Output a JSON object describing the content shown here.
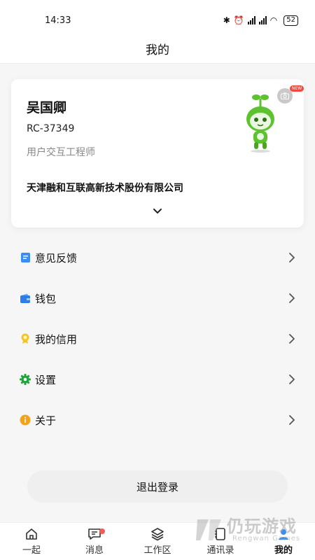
{
  "status_bar": {
    "time": "14:33",
    "battery": "52"
  },
  "header": {
    "title": "我的"
  },
  "profile": {
    "name": "吴国卿",
    "id": "RC-37349",
    "role": "用户交互工程师",
    "company": "天津融和互联高新技术股份有限公司",
    "badge": "NEW"
  },
  "menu": {
    "items": [
      {
        "label": "意见反馈",
        "icon": "feedback-icon",
        "color": "#3b8cf5"
      },
      {
        "label": "钱包",
        "icon": "wallet-icon",
        "color": "#2f7de8"
      },
      {
        "label": "我的信用",
        "icon": "credit-icon",
        "color": "#f3c623"
      },
      {
        "label": "设置",
        "icon": "gear-icon",
        "color": "#1fa63b"
      },
      {
        "label": "关于",
        "icon": "info-icon",
        "color": "#f3a21b"
      }
    ]
  },
  "logout_label": "退出登录",
  "tabs": [
    {
      "label": "一起",
      "icon": "home-icon"
    },
    {
      "label": "消息",
      "icon": "message-icon"
    },
    {
      "label": "工作区",
      "icon": "layers-icon"
    },
    {
      "label": "通讯录",
      "icon": "contacts-icon"
    },
    {
      "label": "我的",
      "icon": "person-icon",
      "active": true
    }
  ],
  "watermark": {
    "title": "仍玩游戏",
    "subtitle": "Rengwan Games"
  },
  "colors": {
    "accent": "#3b8cf5",
    "badge": "#f25c54",
    "mascot": "#5cc22e"
  }
}
